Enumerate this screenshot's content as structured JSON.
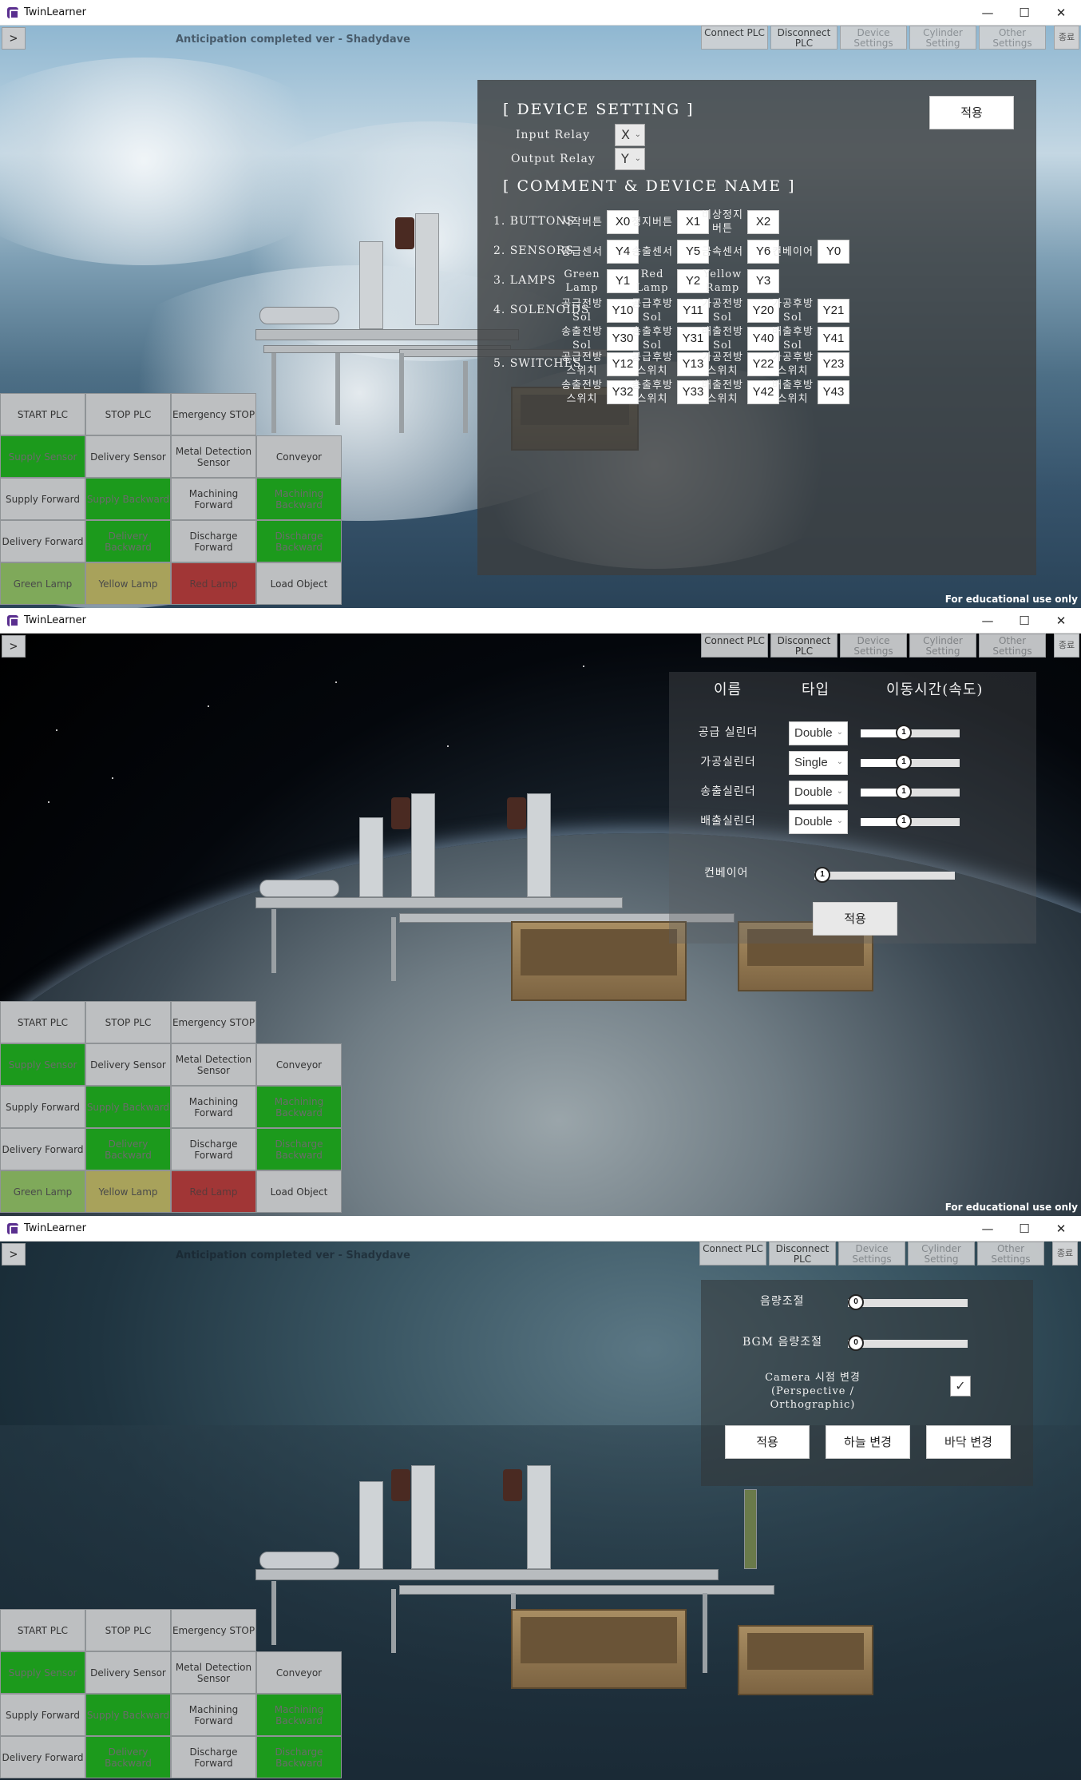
{
  "app_title": "TwinLearner",
  "window_controls": {
    "minimize": "—",
    "maximize": "☐",
    "close": "✕"
  },
  "toggle_label": ">",
  "ghost_title": "Anticipation completed ver - Shadydave",
  "top_buttons": [
    "Connect PLC",
    "Disconnect PLC",
    "Device Settings",
    "Cylinder Setting",
    "Other Settings"
  ],
  "quit_label": "종료",
  "edu_note": "For educational use only",
  "control_grid": [
    [
      "START PLC",
      "STOP PLC",
      "Emergency STOP",
      ""
    ],
    [
      "Supply Sensor",
      "Delivery Sensor",
      "Metal Detection Sensor",
      "Conveyor"
    ],
    [
      "Supply Forward",
      "Supply Backward",
      "Machining Forward",
      "Machining Backward"
    ],
    [
      "Delivery Forward",
      "Delivery Backward",
      "Discharge Forward",
      "Discharge Backward"
    ],
    [
      "Green Lamp",
      "Yellow Lamp",
      "Red Lamp",
      "Load Object"
    ]
  ],
  "device_panel": {
    "title": "[ DEVICE SETTING ]",
    "apply": "적용",
    "input_relay_label": "Input Relay",
    "input_relay_value": "X",
    "output_relay_label": "Output Relay",
    "output_relay_value": "Y",
    "comment_title": "[ COMMENT & DEVICE NAME ]",
    "groups": [
      {
        "label": "1. BUTTONS",
        "items": [
          [
            "시작버튼",
            "X0"
          ],
          [
            "정지버튼",
            "X1"
          ],
          [
            "비상정지 버튼",
            "X2"
          ]
        ]
      },
      {
        "label": "2. SENSORS",
        "items": [
          [
            "공급센서",
            "Y4"
          ],
          [
            "송출센서",
            "Y5"
          ],
          [
            "금속센서",
            "Y6"
          ],
          [
            "컨베이어",
            "Y0"
          ]
        ]
      },
      {
        "label": "3. LAMPS",
        "items": [
          [
            "Green Lamp",
            "Y1"
          ],
          [
            "Red Lamp",
            "Y2"
          ],
          [
            "Yellow Ramp",
            "Y3"
          ]
        ]
      },
      {
        "label": "4. SOLENOIDS",
        "items": [
          [
            "공급전방 Sol",
            "Y10"
          ],
          [
            "공급후방 Sol",
            "Y11"
          ],
          [
            "가공전방 Sol",
            "Y20"
          ],
          [
            "가공후방 Sol",
            "Y21"
          ]
        ]
      },
      {
        "label": "",
        "items": [
          [
            "송출전방 Sol",
            "Y30"
          ],
          [
            "송출후방 Sol",
            "Y31"
          ],
          [
            "배출전방 Sol",
            "Y40"
          ],
          [
            "배출후방 Sol",
            "Y41"
          ]
        ]
      },
      {
        "label": "5. SWITCHES",
        "items": [
          [
            "공급전방 스위치",
            "Y12"
          ],
          [
            "공급후방 스위치",
            "Y13"
          ],
          [
            "가공전방 스위치",
            "Y22"
          ],
          [
            "가공후방 스위치",
            "Y23"
          ]
        ]
      },
      {
        "label": "",
        "items": [
          [
            "송출전방 스위치",
            "Y32"
          ],
          [
            "송출후방 스위치",
            "Y33"
          ],
          [
            "배출전방 스위치",
            "Y42"
          ],
          [
            "배출후방 스위치",
            "Y43"
          ]
        ]
      }
    ]
  },
  "cylinder_panel": {
    "headers": [
      "이름",
      "타입",
      "이동시간(속도)"
    ],
    "rows": [
      {
        "name": "공급 실린더",
        "type": "Double",
        "speed": "1",
        "level": 0.42
      },
      {
        "name": "가공실린더",
        "type": "Single",
        "speed": "1",
        "level": 0.42
      },
      {
        "name": "송출실린더",
        "type": "Double",
        "speed": "1",
        "level": 0.42
      },
      {
        "name": "배출실린더",
        "type": "Double",
        "speed": "1",
        "level": 0.42
      }
    ],
    "conveyor": {
      "name": "컨베이어",
      "speed": "1",
      "level": 0.0
    },
    "apply": "적용"
  },
  "other_panel": {
    "volume_label": "음량조절",
    "volume_value": "0",
    "volume_level": 0.0,
    "bgm_label": "BGM 음량조절",
    "bgm_value": "0",
    "bgm_level": 0.0,
    "camera_label_1": "Camera 시점 변경",
    "camera_label_2": "(Perspective / Orthographic)",
    "camera_checked": "✓",
    "apply": "적용",
    "sky_change": "하늘 변경",
    "floor_change": "바닥 변경"
  },
  "colors": {
    "active_green": "#1c9a1c",
    "lamp_green": "#7fa95a",
    "lamp_yellow": "#a8a25b",
    "lamp_red": "#a13636"
  }
}
